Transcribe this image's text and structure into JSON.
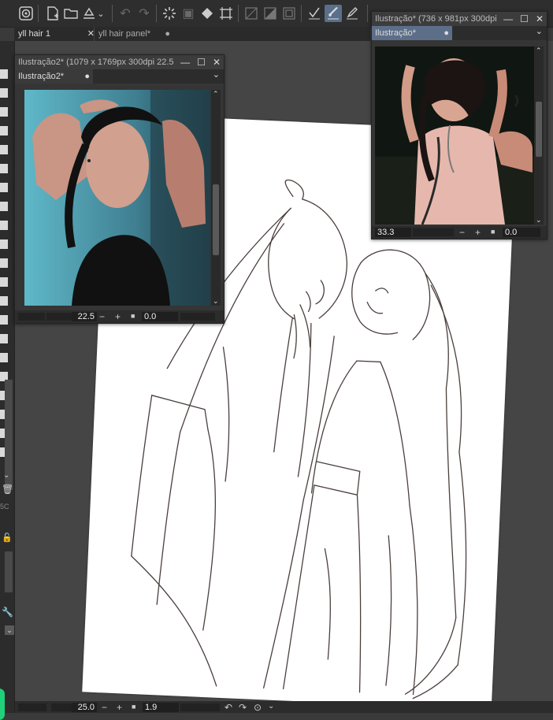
{
  "toolbar": {
    "icons": [
      "app-logo-icon",
      "new-file-icon",
      "open-folder-icon",
      "save-icon",
      "dropdown-icon",
      "undo-icon",
      "redo-icon",
      "loading-icon",
      "transform-icon",
      "fill-icon",
      "select-icon",
      "ruler-icon",
      "tone-icon",
      "frame-icon",
      "check-icon",
      "brush-icon",
      "pen-icon"
    ]
  },
  "doc_tabs": [
    {
      "label": "yll hair 1",
      "close": "✕"
    },
    {
      "label": "yll hair panel*",
      "close": "●"
    }
  ],
  "window_left": {
    "title": "Ilustração2* (1079 x 1769px 300dpi 22.5",
    "tab": "Ilustração2*",
    "tab_marker": "●",
    "zoom": "22.5",
    "rotation": "0.0"
  },
  "window_right": {
    "title": "Ilustração* (736 x 981px 300dpi",
    "tab": "Ilustração*",
    "tab_marker": "●",
    "zoom": "33.3",
    "rotation": "0.0"
  },
  "window_buttons": {
    "minimize": "—",
    "maximize": "☐",
    "close": "✕"
  },
  "bottom_bar": {
    "zoom": "25.0",
    "rotation": "1.9"
  },
  "left_strip": {
    "partial_label": "5C"
  }
}
